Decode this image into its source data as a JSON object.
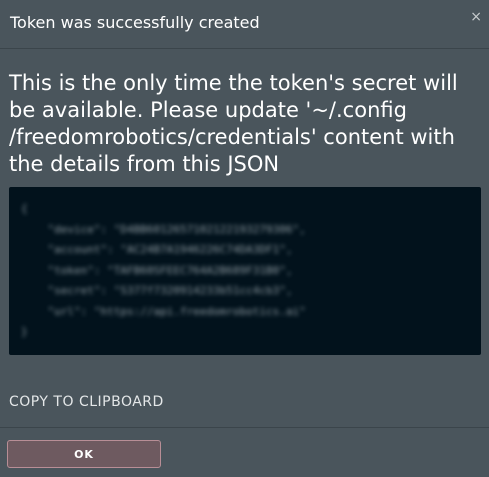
{
  "dialog": {
    "title": "Token was successfully created",
    "close_glyph": "×",
    "message": "This is the only time the token's secret will be available. Please update '~/.config /freedomrobotics/credentials' content with the details from this JSON",
    "code": {
      "open": "{",
      "lines": [
        "    \"device\": \"D4BB6012657102122193279306\",",
        "    \"account\": \"AC24B7A1946226C74DA3DF1\",",
        "    \"token\": \"TAFB60SFEEC764A2B689F31B0\",",
        "    \"secret\": \"S377f7320914233b51cc4cb3\",",
        "    \"url\": \"https://api.freedomrobotics.ai\""
      ],
      "close": "}"
    },
    "copy_label": "COPY TO CLIPBOARD",
    "ok_label": "OK"
  },
  "icons": {
    "close": "close-icon"
  }
}
